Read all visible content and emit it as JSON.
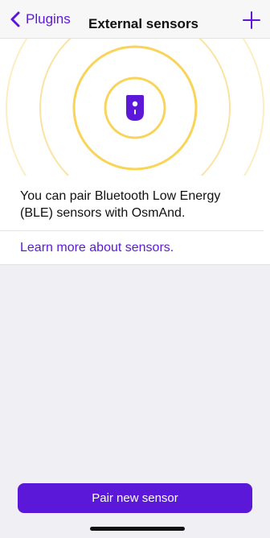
{
  "theme": {
    "accent": "#5c18d8",
    "ring_color": "#f8d458",
    "background": "#efeff4"
  },
  "navbar": {
    "back_label": "Plugins",
    "back_icon": "chevron-left-icon",
    "title": "External sensors",
    "add_icon": "plus-icon"
  },
  "hero": {
    "icon": "sensor-icon",
    "decoration": "concentric-rings"
  },
  "info": {
    "description": "You can pair Bluetooth Low Energy (BLE) sensors with OsmAnd.",
    "learn_more_label": "Learn more about sensors."
  },
  "footer": {
    "pair_button_label": "Pair new sensor"
  }
}
